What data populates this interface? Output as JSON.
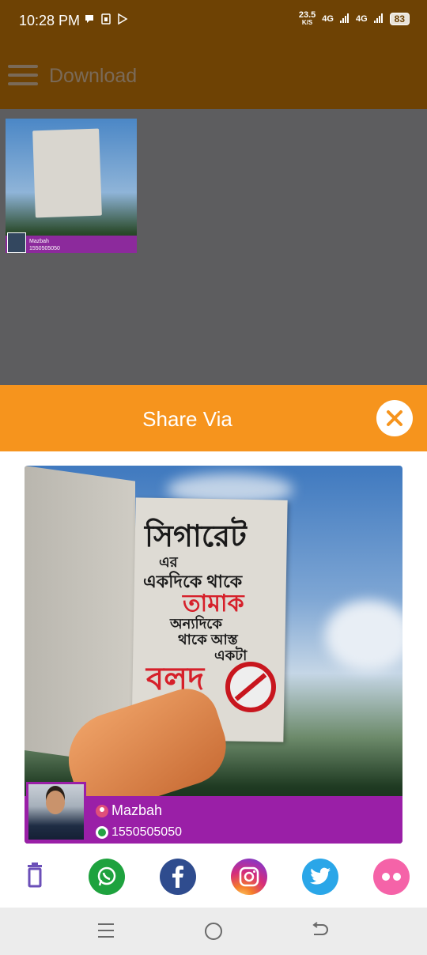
{
  "status_bar": {
    "time": "10:28 PM",
    "net_speed_value": "23.5",
    "net_speed_unit": "K/S",
    "signal1": "4G",
    "signal2": "4G",
    "battery": "83"
  },
  "app_bar": {
    "title": "Download"
  },
  "gallery": {
    "thumb_name": "Mazbah",
    "thumb_phone": "1550505050"
  },
  "share_dialog": {
    "title": "Share Via",
    "preview": {
      "text_lines": [
        "সিগারেট",
        "এর",
        "একদিকে থাকে",
        "তামাক",
        "অন্যদিকে",
        "থাকে আস্ত",
        "একটা",
        "বলদ"
      ],
      "name": "Mazbah",
      "phone": "1550505050"
    },
    "actions": [
      {
        "name": "delete",
        "icon": "trash-icon"
      },
      {
        "name": "whatsapp",
        "icon": "whatsapp-icon"
      },
      {
        "name": "facebook",
        "icon": "facebook-icon"
      },
      {
        "name": "instagram",
        "icon": "instagram-icon"
      },
      {
        "name": "twitter",
        "icon": "twitter-icon"
      },
      {
        "name": "flickr",
        "icon": "flickr-icon"
      }
    ]
  },
  "colors": {
    "app_bar": "#6e4204",
    "share_header": "#f6941d",
    "profile_strip": "#9a1fa7"
  }
}
